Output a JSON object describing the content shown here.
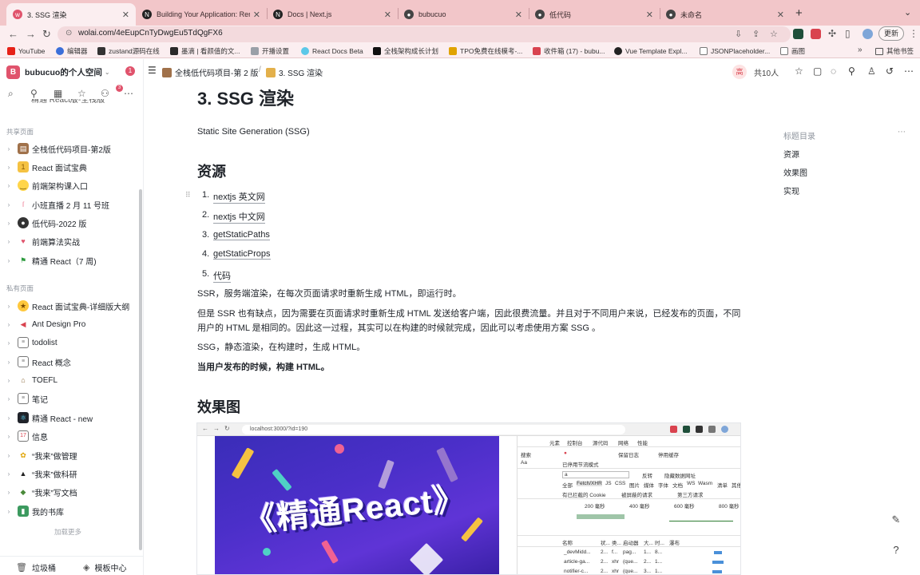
{
  "browser": {
    "tabs": [
      {
        "title": "3. SSG 渲染",
        "active": true,
        "icon": "wolai-icon"
      },
      {
        "title": "Building Your Application: Ren",
        "active": false,
        "icon": "nextjs-icon"
      },
      {
        "title": "Docs | Next.js",
        "active": false,
        "icon": "nextjs-icon"
      },
      {
        "title": "bubucuo",
        "active": false,
        "icon": "github-icon"
      },
      {
        "title": "低代码",
        "active": false,
        "icon": "github-icon"
      },
      {
        "title": "未命名",
        "active": false,
        "icon": "github-icon"
      }
    ],
    "url": "wolai.com/4eEupCnTyDwgEu5TdQgFX6",
    "update_label": "更新",
    "bookmarks": [
      "YouTube",
      "编辑器",
      "zustand源码在线",
      "墨滴 | 看颜值的文...",
      "开播设置",
      "React Docs Beta",
      "全栈架构成长计划",
      "TPO免费在线模考-...",
      "收件箱 (17) - bubu...",
      "Vue Template Expl...",
      "JSONPlaceholder...",
      "画图"
    ],
    "bookmarks_more": "»",
    "bookmarks_folder": "其他书签"
  },
  "sidebar": {
    "avatar": "B",
    "workspace": "bubucuo的个人空间",
    "badge": "1",
    "tool_badge": "3",
    "cut_item": "精通 React版-全栈版",
    "shared_section": "共享页面",
    "shared_items": [
      {
        "label": "全栈低代码项目-第2版",
        "emoji": "📜"
      },
      {
        "label": "React 面试宝典",
        "emoji": "🥇"
      },
      {
        "label": "前端架构课入口",
        "emoji": "🙂"
      },
      {
        "label": "小班直播 2 月 11 号班",
        "emoji": "🦩"
      },
      {
        "label": "低代码-2022 版",
        "emoji": "🐼"
      },
      {
        "label": "前端算法实战",
        "emoji": "❤"
      },
      {
        "label": "精通 React（7 周)",
        "emoji": "⛳"
      }
    ],
    "private_section": "私有页面",
    "private_items": [
      {
        "label": "React 面试宝典-详细版大纲",
        "emoji": "🤩"
      },
      {
        "label": "Ant Design Pro",
        "emoji": "🐟"
      },
      {
        "label": "todolist",
        "emoji": "▤"
      },
      {
        "label": "React 概念",
        "emoji": "▤"
      },
      {
        "label": "TOEFL",
        "emoji": "🏛"
      },
      {
        "label": "笔记",
        "emoji": "▤"
      },
      {
        "label": "精通 React - new",
        "emoji": "⚛"
      },
      {
        "label": "信息",
        "emoji": "📅"
      },
      {
        "label": "“我来”做管理",
        "emoji": "🍍"
      },
      {
        "label": "“我来”做科研",
        "emoji": "🎓"
      },
      {
        "label": "“我来”写文档",
        "emoji": "🦆"
      },
      {
        "label": "我的书库",
        "emoji": "📗"
      }
    ],
    "load_more": "加载更多",
    "trash": "垃圾桶",
    "templates": "模板中心"
  },
  "docbar": {
    "crumb1": "全栈低代码项目-第 2 版",
    "crumb2": "3. SSG 渲染",
    "user_initial": "高",
    "people": "共10人"
  },
  "doc": {
    "title": "3. SSG 渲染",
    "intro": "Static Site Generation (SSG)",
    "h_resources": "资源",
    "resources": [
      "nextjs 英文网",
      "nextjs 中文网",
      "getStaticPaths",
      "getStaticProps",
      "代码"
    ],
    "p1": "SSR，服务端渲染，在每次页面请求时重新生成 HTML，即运行时。",
    "p2a": "但是 SSR 也有缺点，因为需要在页面请求时重新生成 HTML 发送给客户端，因此很费流量。并且对于不同用户来说，已经发布的页面，不同",
    "p2b": "用户的 HTML 是相同的。因此这一过程，其实可以在构建的时候就完成，因此可以考虑使用方案 SSG 。",
    "p3": "SSG，静态渲染，在构建时，生成 HTML。",
    "p4": "当用户发布的时候，构建 HTML。",
    "h_effect": "效果图"
  },
  "toc": {
    "title": "标题目录",
    "items": [
      "资源",
      "效果图",
      "实现"
    ]
  },
  "embedded": {
    "url": "localhost:3000/?id=190",
    "poster_title": "《精通React》",
    "devtools_tabs": [
      "元素",
      "控制台",
      "源代码",
      "网络",
      "性能"
    ],
    "search_label": "搜索",
    "preserve_log": "保留日志",
    "disable_cache": "停用缓存",
    "throttle": "已停用节流模式",
    "filter_value": "a",
    "invert": "反转",
    "hide_data_urls": "隐藏数据网址",
    "filter_types": [
      "全部",
      "Fetch/XHR",
      "JS",
      "CSS",
      "图片",
      "媒体",
      "字体",
      "文档",
      "WS",
      "Wasm",
      "清单",
      "其他"
    ],
    "blocked_cookies": "有已拦截的 Cookie",
    "blocked_requests": "被屏蔽的请求",
    "third_party": "第三方请求",
    "timeline_ticks": [
      "200 毫秒",
      "400 毫秒",
      "600 毫秒",
      "800 毫秒"
    ],
    "columns": [
      "名称",
      "状...",
      "类...",
      "启动器",
      "大...",
      "时...",
      "瀑布"
    ],
    "rows": [
      [
        "_devMidd...",
        "2...",
        "f...",
        "pag...",
        "1...",
        "8..."
      ],
      [
        "article-ga...",
        "2...",
        "xhr",
        "(que...",
        "2...",
        "1..."
      ],
      [
        "notifier-c...",
        "2...",
        "xhr",
        "(que...",
        "3...",
        "1..."
      ]
    ]
  }
}
